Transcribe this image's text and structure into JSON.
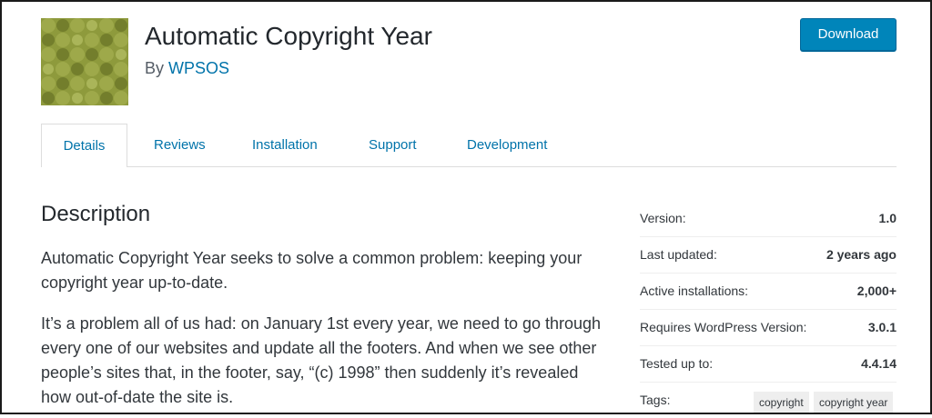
{
  "plugin": {
    "title": "Automatic Copyright Year",
    "by_label": "By",
    "author": "WPSOS",
    "icon_color": "#8e9a3c"
  },
  "header": {
    "download_label": "Download"
  },
  "tabs": [
    {
      "label": "Details",
      "active": true
    },
    {
      "label": "Reviews",
      "active": false
    },
    {
      "label": "Installation",
      "active": false
    },
    {
      "label": "Support",
      "active": false
    },
    {
      "label": "Development",
      "active": false
    }
  ],
  "description": {
    "heading": "Description",
    "paragraphs": [
      "Automatic Copyright Year seeks to solve a common problem: keeping your copyright year up-to-date.",
      "It’s a problem all of us had: on January 1st every year, we need to go through every one of our websites and update all the footers. And when we see other people’s sites that, in the footer, say, “(c) 1998” then suddenly it’s revealed how out-of-date the site is."
    ]
  },
  "meta": [
    {
      "label": "Version:",
      "value": "1.0"
    },
    {
      "label": "Last updated:",
      "value": "2 years ago"
    },
    {
      "label": "Active installations:",
      "value": "2,000+"
    },
    {
      "label": "Requires WordPress Version:",
      "value": "3.0.1"
    },
    {
      "label": "Tested up to:",
      "value": "4.4.14"
    }
  ],
  "tags": {
    "label": "Tags:",
    "items": [
      "copyright",
      "copyright year"
    ]
  },
  "colors": {
    "accent": "#0073aa",
    "button": "#0085ba"
  }
}
